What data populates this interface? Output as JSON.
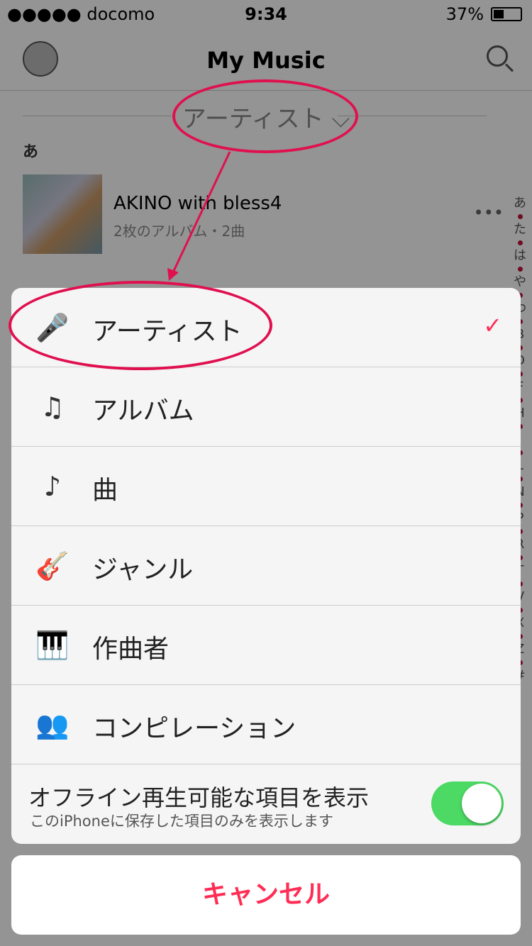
{
  "status": {
    "carrier": "●●●●● docomo",
    "time": "9:34",
    "battery": "37%"
  },
  "nav": {
    "title": "My Music",
    "avatar": "profile-icon",
    "search": "search-icon"
  },
  "filter": {
    "label": "アーティスト ⌵"
  },
  "list": {
    "section": "あ",
    "rows": [
      {
        "title": "AKINO with bless4",
        "subtitle": "2枚のアルバム・2曲"
      }
    ],
    "more": "•••"
  },
  "index": [
    "あ",
    "た",
    "は",
    "や",
    "わ",
    "B",
    "D",
    "F",
    "H",
    "J",
    "L",
    "N",
    "P",
    "R",
    "T",
    "V",
    "X",
    "Z",
    "#"
  ],
  "sheet": {
    "items": [
      {
        "label": "アーティスト",
        "icon": "microphone-icon",
        "glyph": "🎤",
        "selected": true
      },
      {
        "label": "アルバム",
        "icon": "album-icon",
        "glyph": "♫"
      },
      {
        "label": "曲",
        "icon": "music-note-icon",
        "glyph": "♪"
      },
      {
        "label": "ジャンル",
        "icon": "guitars-icon",
        "glyph": "🎸"
      },
      {
        "label": "作曲者",
        "icon": "piano-icon",
        "glyph": "🎹"
      },
      {
        "label": "コンピレーション",
        "icon": "compilation-icon",
        "glyph": "👥"
      }
    ],
    "check": "✓",
    "offline": {
      "title": "オフライン再生可能な項目を表示",
      "subtitle": "このiPhoneに保存した項目のみを表示します",
      "on": true
    }
  },
  "cancel": "キャンセル",
  "colors": {
    "accent": "#ff2d55",
    "toggle": "#4cd964",
    "annotation": "#e0104f"
  }
}
